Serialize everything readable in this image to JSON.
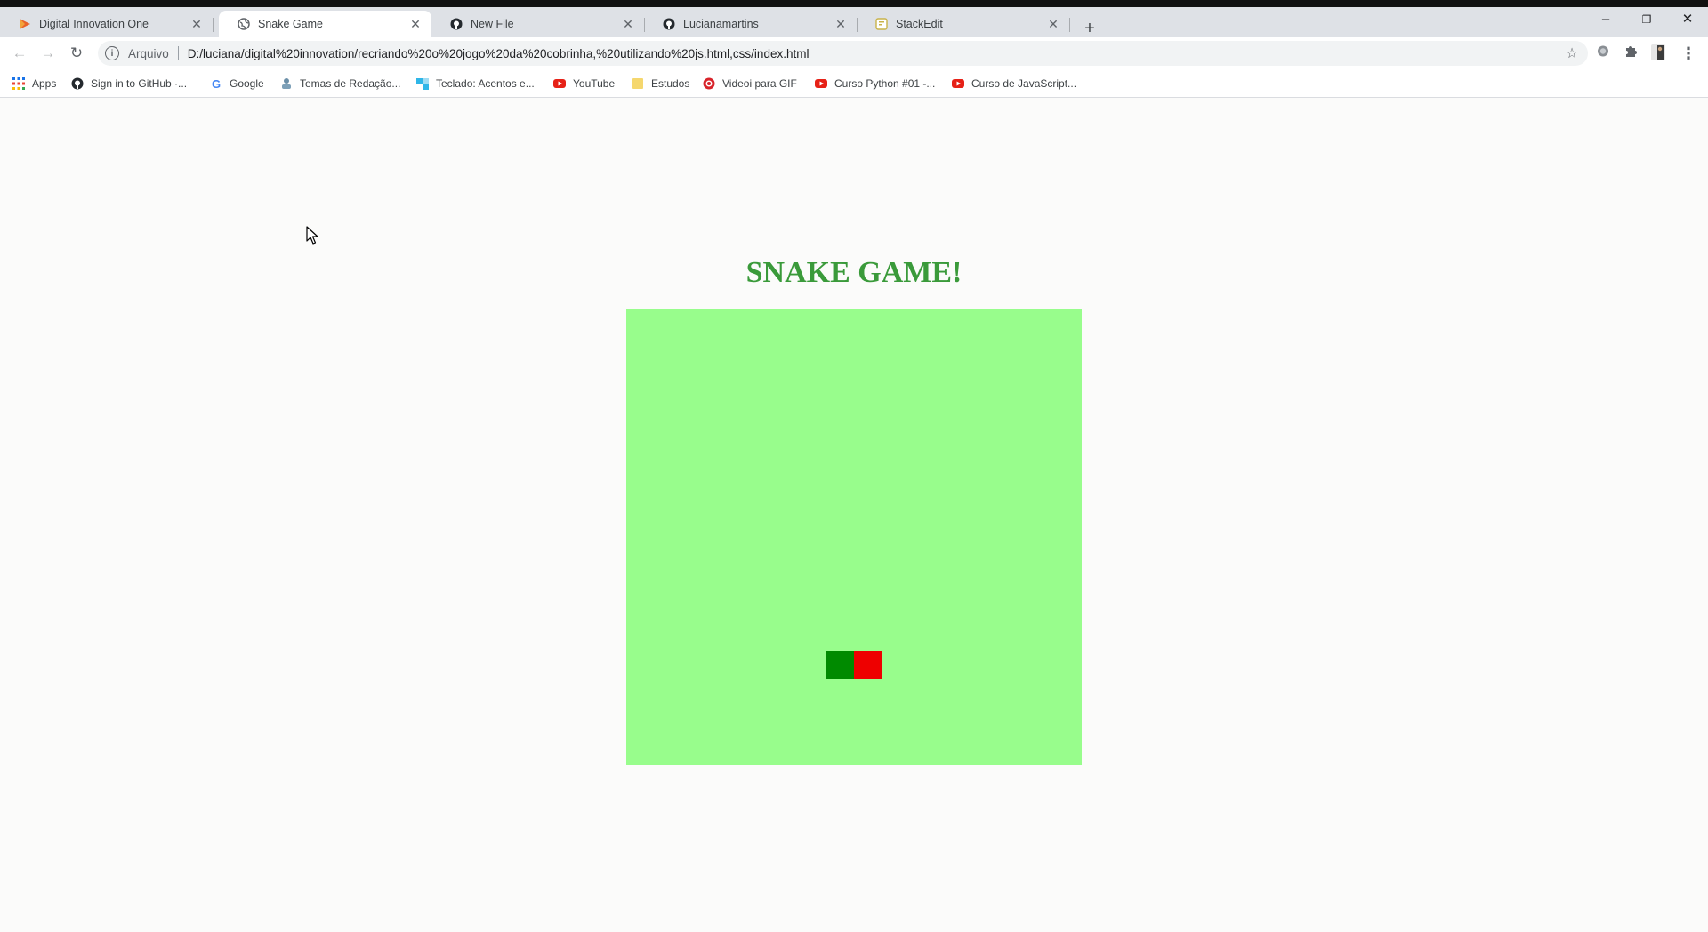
{
  "browser": {
    "tabs": [
      {
        "label": "Digital Innovation One",
        "favicon": "dio-icon",
        "active": false
      },
      {
        "label": "Snake Game",
        "favicon": "globe-icon",
        "active": true
      },
      {
        "label": "New File",
        "favicon": "github-icon",
        "active": false
      },
      {
        "label": "Lucianamartins",
        "favicon": "github-icon",
        "active": false
      },
      {
        "label": "StackEdit",
        "favicon": "stackedit-icon",
        "active": false
      }
    ],
    "new_tab_label": "+",
    "window_controls": {
      "minimize": "–",
      "restore": "❐",
      "close": "✕"
    }
  },
  "toolbar": {
    "back": "←",
    "forward": "→",
    "reload": "↻",
    "scheme_label": "Arquivo",
    "url": "D:/luciana/digital%20innovation/recriando%20o%20jogo%20da%20cobrinha,%20utilizando%20js.html,css/index.html",
    "star": "☆"
  },
  "bookmarks": [
    {
      "label": "Apps",
      "icon": "apps-grid-icon"
    },
    {
      "label": "Sign in to GitHub ·...",
      "icon": "github-icon"
    },
    {
      "label": "Google",
      "icon": "google-icon"
    },
    {
      "label": "Temas de Redação...",
      "icon": "bookmark-site-icon"
    },
    {
      "label": "Teclado: Acentos e...",
      "icon": "bookmark-site-icon"
    },
    {
      "label": "YouTube",
      "icon": "youtube-icon"
    },
    {
      "label": "Estudos",
      "icon": "folder-icon"
    },
    {
      "label": "Videoi para GIF",
      "icon": "bookmark-site-icon"
    },
    {
      "label": "Curso Python #01 -...",
      "icon": "youtube-icon"
    },
    {
      "label": "Curso de JavaScript...",
      "icon": "youtube-icon"
    }
  ],
  "game": {
    "title": "SNAKE GAME!",
    "board_color": "#98fd8c",
    "grid_size": 16,
    "snake_color": "#008a00",
    "food_color": "#ee0000",
    "snake": [
      {
        "col": 7,
        "row": 12
      }
    ],
    "food": {
      "col": 8,
      "row": 12
    }
  }
}
